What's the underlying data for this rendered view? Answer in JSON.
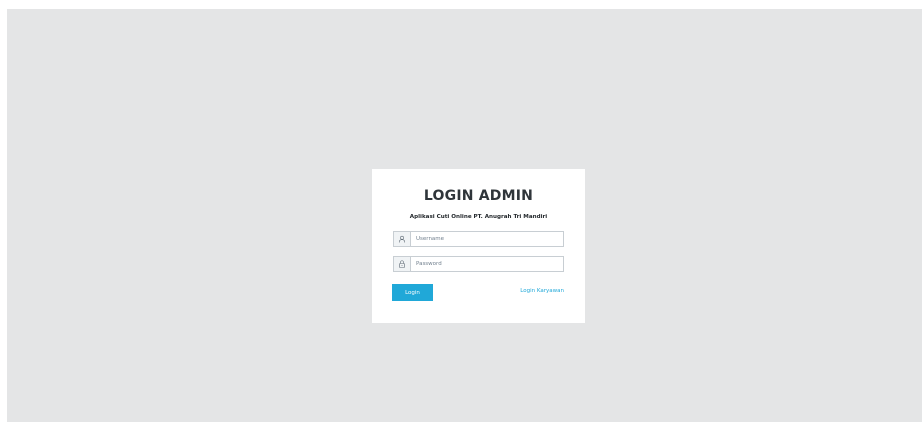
{
  "login": {
    "title": "LOGIN ADMIN",
    "subtitle": "Aplikasi Cuti Online PT. Anugrah Tri Mandiri",
    "username": {
      "placeholder": "Username",
      "value": "",
      "icon": "user-icon"
    },
    "password": {
      "placeholder": "Password",
      "value": "",
      "icon": "lock-icon"
    },
    "login_button_label": "Login",
    "karyawan_link_label": "Login Karyawan"
  },
  "colors": {
    "page_background": "#e4e5e6",
    "card_background": "#ffffff",
    "accent": "#20a8d8",
    "title_text": "#2f353a",
    "input_border": "#c8ced3",
    "addon_background": "#f0f3f5"
  }
}
